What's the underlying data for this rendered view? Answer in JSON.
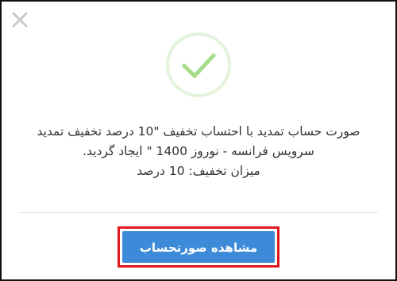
{
  "dialog": {
    "close_icon": "close-icon",
    "status_icon": "checkmark-icon",
    "success_color": "#a6dc8c",
    "message_lines": [
      "صورت حساب تمدید با احتساب تخفیف \"10 درصد تخفیف تمدید",
      "سرویس فرانسه - نوروز 1400 \" ایجاد گردید.",
      "میزان تخفیف: 10 درصد"
    ],
    "primary_button_label": "مشاهده صورتحساب",
    "primary_button_color": "#3d8bd8",
    "highlight_color": "#e0191f"
  }
}
